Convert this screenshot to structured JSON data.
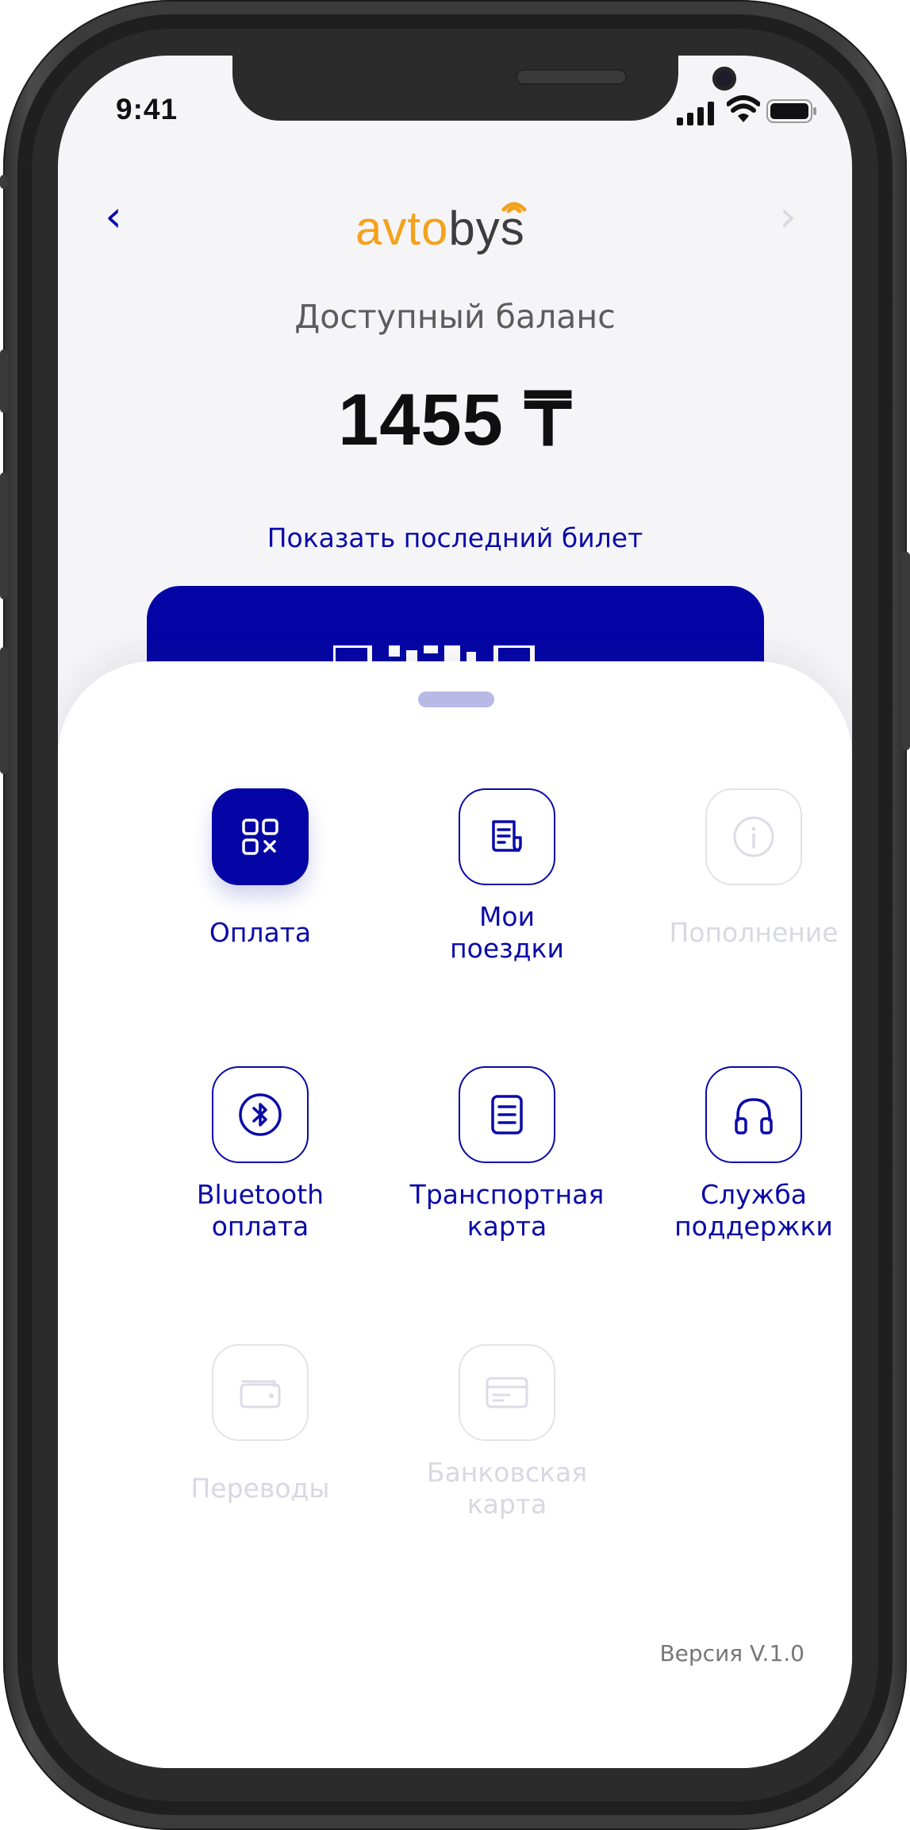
{
  "status_bar": {
    "time": "9:41",
    "signal_icon": "cellular-signal-icon",
    "wifi_icon": "wifi-icon",
    "battery_icon": "battery-icon"
  },
  "header": {
    "back_icon": "‹",
    "forward_icon": "›",
    "logo_part_1": "avto",
    "logo_part_2": "bys"
  },
  "balance": {
    "label": "Доступный баланс",
    "amount": "1455 ₸"
  },
  "last_ticket_link": "Показать последний билет",
  "menu": [
    {
      "id": "payment",
      "label": "Оплата",
      "icon": "qr-code-icon",
      "state": "active"
    },
    {
      "id": "my-trips",
      "label": "Мои\nпоездки",
      "icon": "document-icon",
      "state": "enabled"
    },
    {
      "id": "top-up",
      "label": "Пополнение",
      "icon": "info-icon",
      "state": "disabled"
    },
    {
      "id": "bluetooth-payment",
      "label": "Bluetooth\nоплата",
      "icon": "bluetooth-icon",
      "state": "enabled"
    },
    {
      "id": "transport-card",
      "label": "Транспортная\nкарта",
      "icon": "card-document-icon",
      "state": "enabled"
    },
    {
      "id": "support",
      "label": "Служба\nподдержки",
      "icon": "headphones-icon",
      "state": "enabled"
    },
    {
      "id": "transfers",
      "label": "Переводы",
      "icon": "wallet-icon",
      "state": "disabled"
    },
    {
      "id": "bank-card",
      "label": "Банковская\nкарта",
      "icon": "credit-card-icon",
      "state": "disabled"
    }
  ],
  "version": "Версия V.1.0",
  "colors": {
    "accent": "#0A0AA8",
    "logo_orange": "#F4A21D",
    "disabled": "#D8D8E2"
  }
}
